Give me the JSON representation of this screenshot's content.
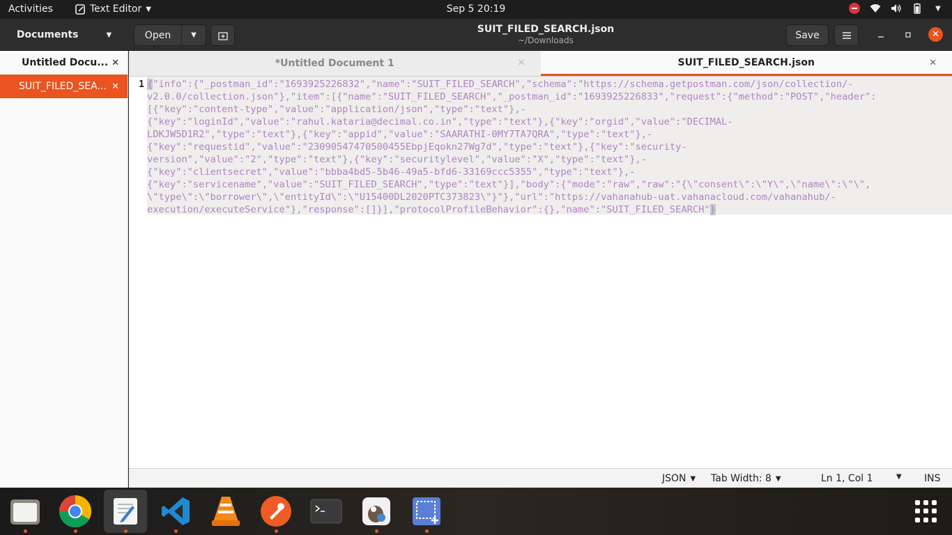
{
  "topbar": {
    "activities": "Activities",
    "app_name": "Text Editor",
    "clock": "Sep 5  20:19"
  },
  "header": {
    "documents_label": "Documents",
    "open_label": "Open",
    "title": "SUIT_FILED_SEARCH.json",
    "subtitle": "~/Downloads",
    "save_label": "Save"
  },
  "sidebar": {
    "items": [
      {
        "label": "Untitled Docu..."
      },
      {
        "label": "SUIT_FILED_SEA..."
      }
    ]
  },
  "tabs": [
    {
      "label": "*Untitled Document 1"
    },
    {
      "label": "SUIT_FILED_SEARCH.json"
    }
  ],
  "editor": {
    "line_number": "1",
    "first_char": "{",
    "last_char": "}",
    "rows": [
      "\"info\":{\"_postman_id\":\"1693925226832\",\"name\":\"SUIT_FILED_SEARCH\",\"schema\":\"https://schema.getpostman.com/json/collection/-",
      "v2.0.0/collection.json\"},\"item\":[{\"name\":\"SUIT_FILED_SEARCH\",\"_postman_id\":\"1693925226833\",\"request\":{\"method\":\"POST\",\"header\":",
      "[{\"key\":\"content-type\",\"value\":\"application/json\",\"type\":\"text\"},-",
      "{\"key\":\"loginId\",\"value\":\"rahul.kataria@decimal.co.in\",\"type\":\"text\"},{\"key\":\"orgid\",\"value\":\"DECIMAL-",
      "LDKJW5D1R2\",\"type\":\"text\"},{\"key\":\"appid\",\"value\":\"SAARATHI-0MY7TA7QRA\",\"type\":\"text\"},-",
      "{\"key\":\"requestid\",\"value\":\"23090547470500455EbpjEqokn27Wg7d\",\"type\":\"text\"},{\"key\":\"security-",
      "version\",\"value\":\"2\",\"type\":\"text\"},{\"key\":\"securitylevel\",\"value\":\"X\",\"type\":\"text\"},-",
      "{\"key\":\"clientsecret\",\"value\":\"bbba4bd5-5b46-49a5-bfd6-33169ccc5355\",\"type\":\"text\"},-",
      "{\"key\":\"servicename\",\"value\":\"SUIT_FILED_SEARCH\",\"type\":\"text\"}],\"body\":{\"mode\":\"raw\",\"raw\":\"{\\\"consent\\\":\\\"Y\\\",\\\"name\\\":\\\"\\\",",
      "\\\"type\\\":\\\"borrower\\\",\\\"entityId\\\":\\\"U15400DL2020PTC373823\\\"}\"},\"url\":\"https://vahanahub-uat.vahanacloud.com/vahanahub/-",
      "execution/executeService\"},\"response\":[]}],\"protocolProfileBehavior\":{},\"name\":\"SUIT_FILED_SEARCH\""
    ]
  },
  "statusbar": {
    "language": "JSON",
    "tab_width": "Tab Width: 8",
    "position": "Ln 1, Col 1",
    "mode": "INS"
  },
  "colors": {
    "accent": "#e95420",
    "string": "#b084c4"
  },
  "dock": {
    "items": [
      "files-icon",
      "chrome-icon",
      "text-editor-icon",
      "vscode-icon",
      "vlc-icon",
      "postman-icon",
      "terminal-icon",
      "gimp-icon",
      "screenshot-icon"
    ]
  }
}
